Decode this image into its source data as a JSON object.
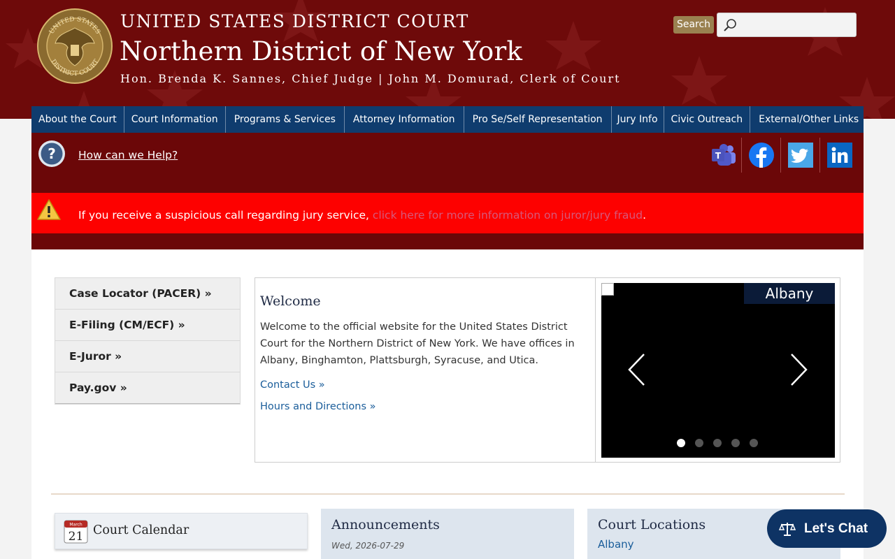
{
  "header": {
    "line1": "UNITED STATES DISTRICT COURT",
    "line2": "Northern District of New York",
    "line3": "Hon. Brenda K. Sannes, Chief Judge | John M. Domurad, Clerk of Court",
    "seal_icon": "court-seal",
    "seal_text_top": "UNITED STATES",
    "seal_text_bottom": "DISTRICT COURT"
  },
  "search": {
    "button_label": "Search",
    "placeholder": "",
    "value": ""
  },
  "nav": {
    "items": [
      "About the Court",
      "Court Information",
      "Programs & Services",
      "Attorney Information",
      "Pro Se/Self Representation",
      "Jury Info",
      "Civic Outreach",
      "External/Other Links"
    ]
  },
  "help": {
    "label": "How can we Help?"
  },
  "social": [
    "teams-icon",
    "facebook-icon",
    "twitter-icon",
    "linkedin-icon"
  ],
  "alert": {
    "text": "If you receive a suspicious call regarding jury service, ",
    "link": "click here for more information on juror/jury fraud",
    "end": "."
  },
  "quick_links": [
    "Case Locator (PACER) »",
    "E-Filing (CM/ECF) »",
    "E-Juror »",
    "Pay.gov »"
  ],
  "welcome": {
    "title": "Welcome",
    "body": "Welcome to the official website for the United States District Court for the Northern District of New York. We have offices in Albany, Binghamton, Plattsburgh, Syracuse, and Utica.",
    "contact": "Contact Us »",
    "hours": "Hours and Directions »"
  },
  "carousel": {
    "caption": "Albany",
    "slide_count": 5,
    "active_slide": 1
  },
  "calendar": {
    "month": "March",
    "day": "21",
    "label": "Court Calendar"
  },
  "announcements": {
    "title": "Announcements",
    "date": "Wed, 2026-07-29"
  },
  "locations": {
    "title": "Court Locations",
    "first": "Albany"
  },
  "chat": {
    "label": "Let's Chat"
  },
  "colors": {
    "header_bg": "#6e0a0a",
    "nav_bg": "#0f3c6e",
    "alert_bg": "#fd0100",
    "search_button": "#9a8150",
    "link": "#1a5d9a"
  }
}
